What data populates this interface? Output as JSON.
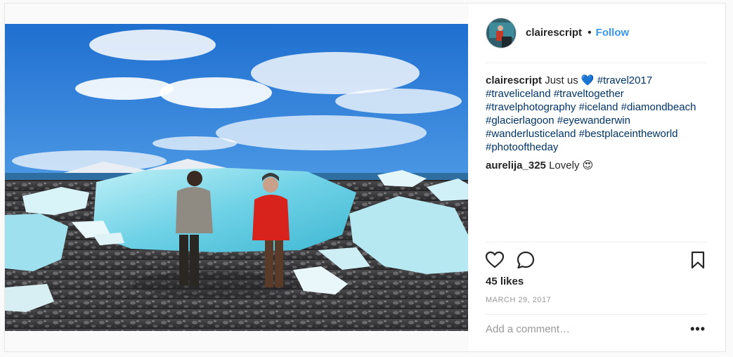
{
  "post": {
    "author": "clairescript",
    "separator": "•",
    "follow_label": "Follow",
    "caption": {
      "user": "clairescript",
      "text": "Just us",
      "emoji": "💙",
      "hashtags": [
        "#travel2017",
        "#traveliceland",
        "#traveltogether",
        "#travelphotography",
        "#iceland",
        "#diamondbeach",
        "#glacierlagoon",
        "#eyewanderwin",
        "#wanderlusticeland",
        "#bestplaceintheworld",
        "#photooftheday"
      ]
    },
    "comment": {
      "user": "aurelija_325",
      "text": "Lovely",
      "emoji": "😍"
    },
    "likes": "45 likes",
    "date": "MARCH 29, 2017",
    "add_comment_placeholder": "Add a comment…",
    "more_label": "•••"
  },
  "icons": {
    "like": "heart-icon",
    "comment": "comment-bubble-icon",
    "save": "bookmark-icon",
    "more": "more-options-icon"
  },
  "colors": {
    "accent": "#3897f0",
    "hashtag": "#003569",
    "muted": "#999999",
    "text": "#262626",
    "border": "#efefef"
  }
}
